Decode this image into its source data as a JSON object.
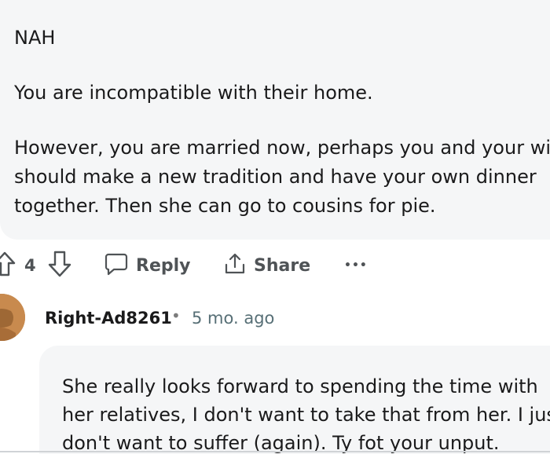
{
  "comment": {
    "paragraphs": [
      "NAH",
      "You are incompatible with their home.",
      "However, you are married now, perhaps you and your wife",
      "should make a new tradition and have your own dinner",
      "together. Then she can go to cousins for pie."
    ]
  },
  "actions": {
    "vote_count": "4",
    "reply_label": "Reply",
    "share_label": "Share",
    "more_label": "•••"
  },
  "reply": {
    "author": "Right-Ad8261",
    "separator": "•",
    "time": "5 mo. ago",
    "lines": [
      "She really looks forward to spending the time with",
      "her relatives, I don't want to take that from her. I just",
      "don't want to suffer (again). Ty fot your unput."
    ]
  },
  "colors": {
    "bubble_bg": "#f5f6f7",
    "text": "#1a1a1b",
    "muted": "#576f76",
    "avatar": "#c88a4e"
  }
}
